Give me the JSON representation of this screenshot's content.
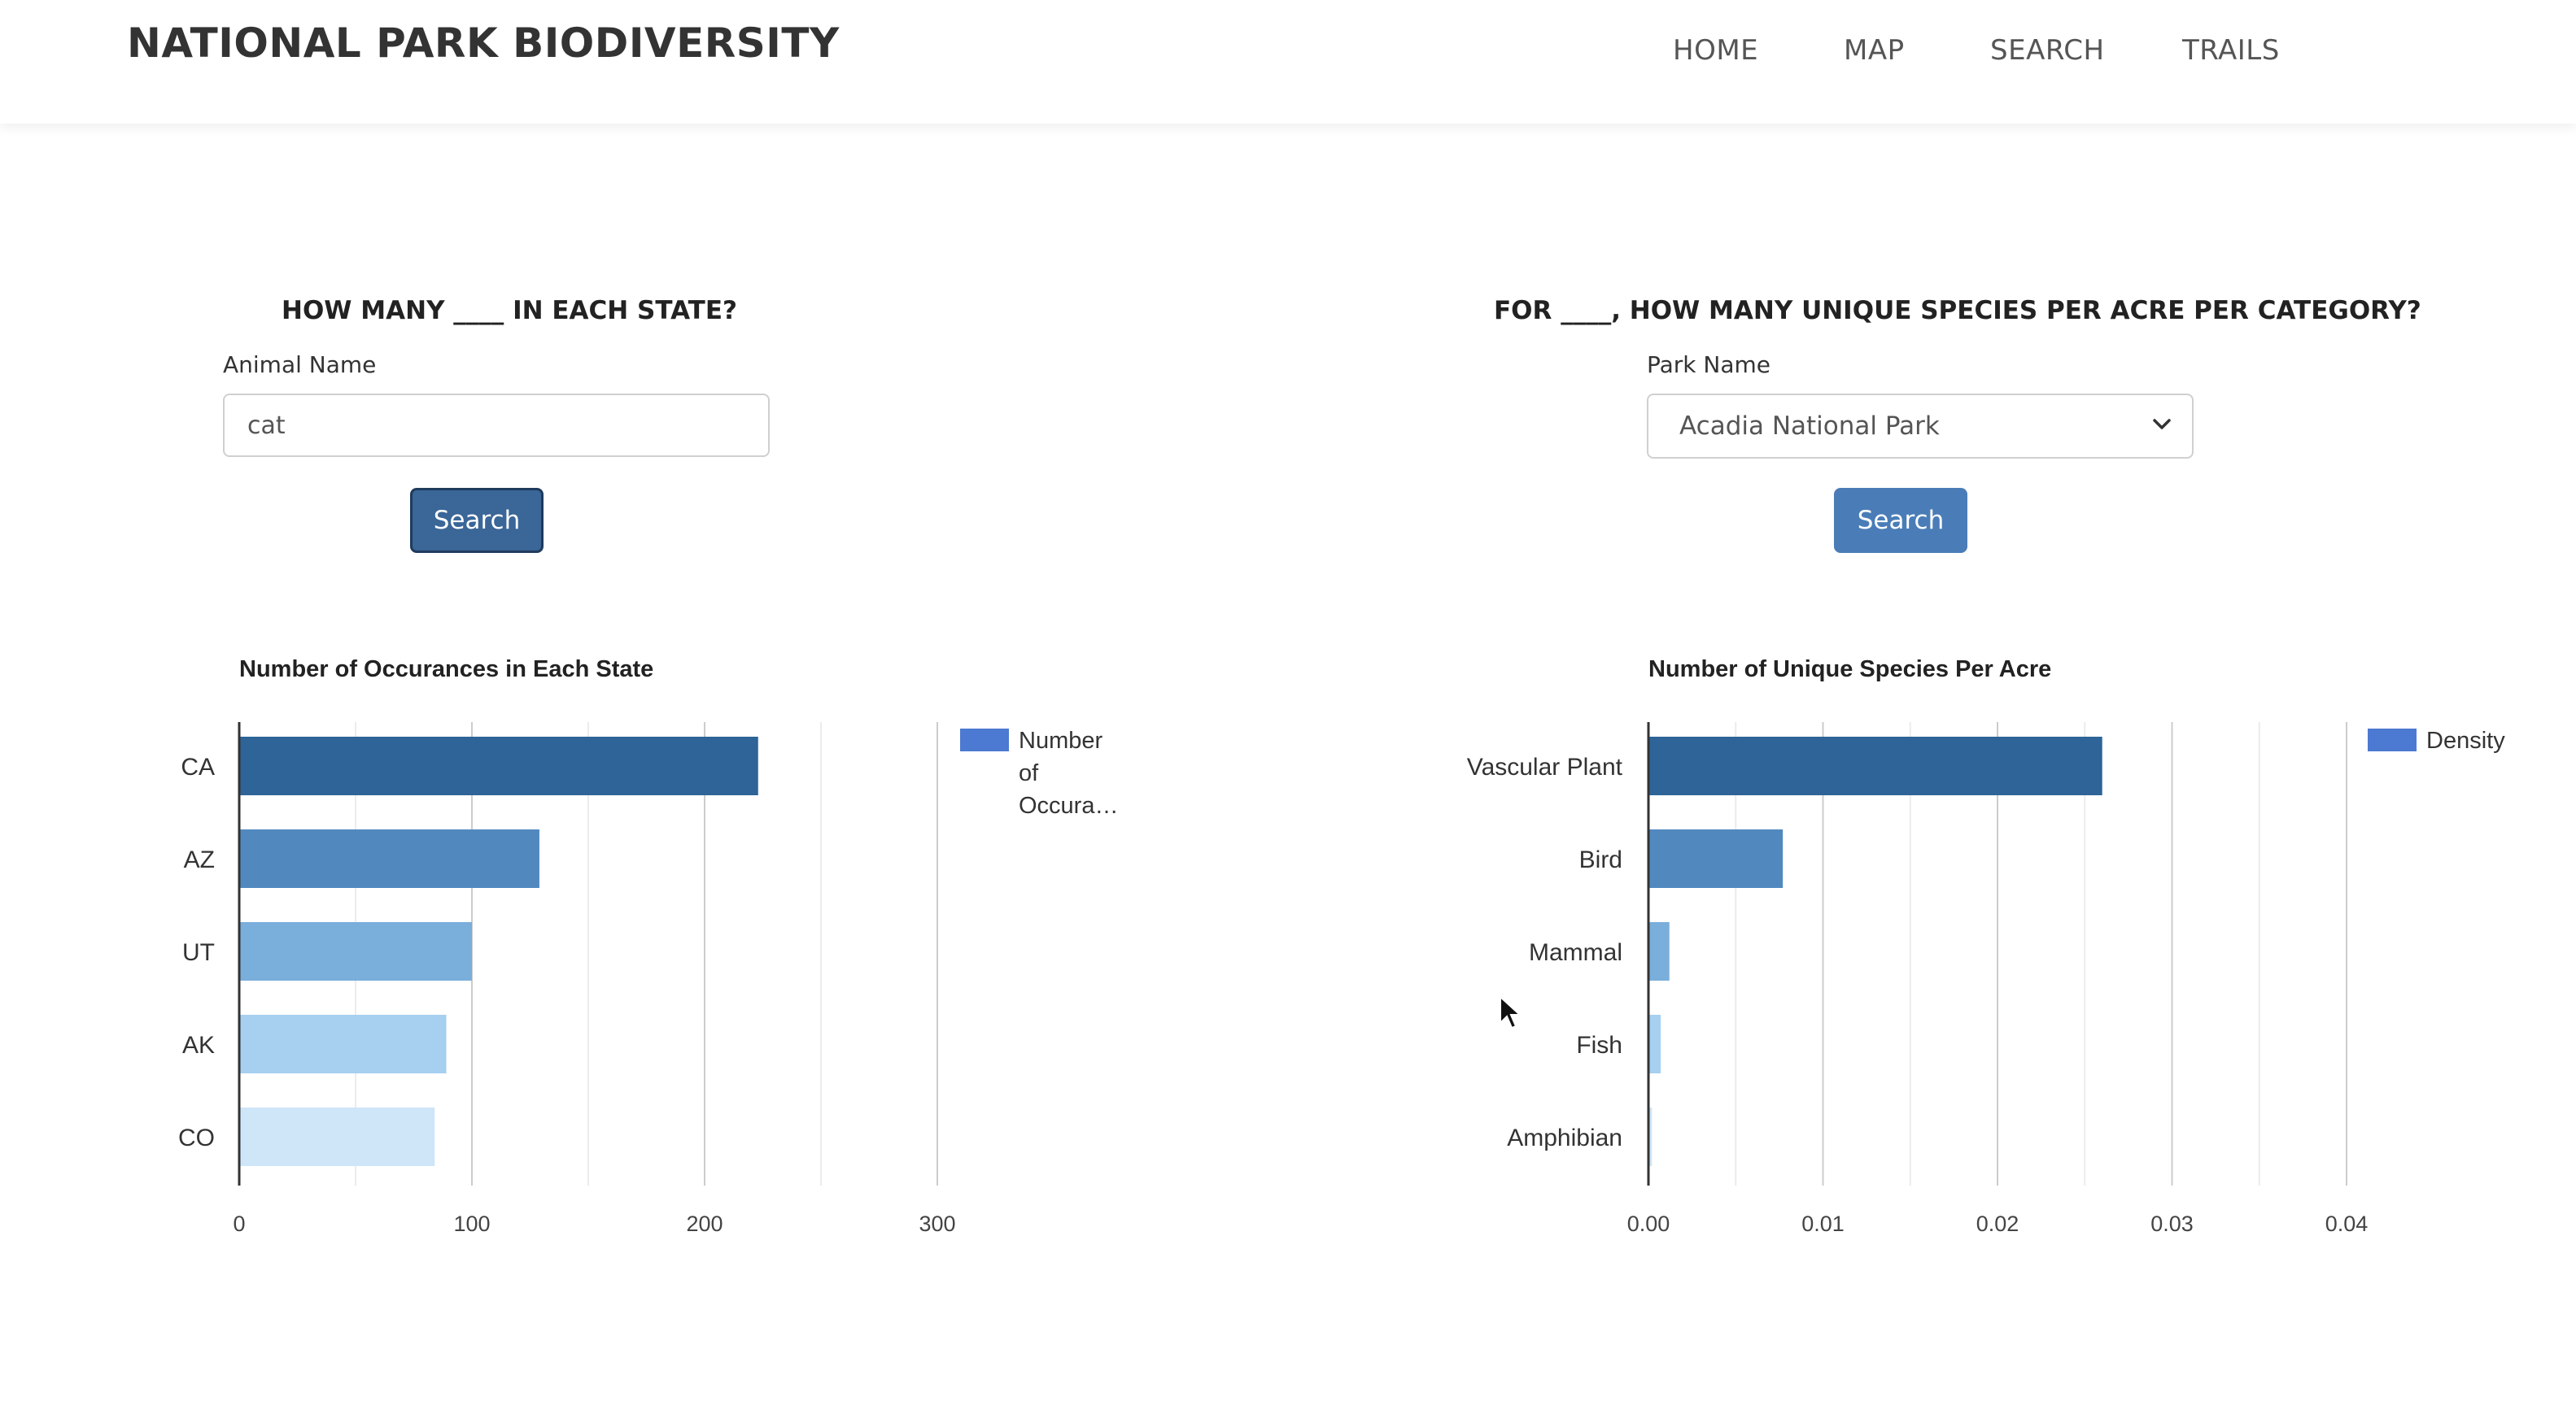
{
  "app": {
    "title": "NATIONAL PARK BIODIVERSITY"
  },
  "nav": {
    "items": [
      "HOME",
      "MAP",
      "SEARCH",
      "TRAILS"
    ]
  },
  "left_panel": {
    "title": "HOW MANY ____ IN EACH STATE?",
    "field_label": "Animal Name",
    "input_value": "cat",
    "button_label": "Search"
  },
  "right_panel": {
    "title": "FOR ____, HOW MANY UNIQUE SPECIES PER ACRE PER CATEGORY?",
    "field_label": "Park Name",
    "select_value": "Acadia National Park",
    "button_label": "Search"
  },
  "chart_data": [
    {
      "type": "bar",
      "orientation": "horizontal",
      "title": "Number of Occurances in Each State",
      "categories": [
        "CA",
        "AZ",
        "UT",
        "AK",
        "CO"
      ],
      "series": [
        {
          "name": "Number of Occura…",
          "values": [
            223,
            129,
            100,
            89,
            84
          ]
        }
      ],
      "bar_colors": [
        "#2e6497",
        "#5189bf",
        "#7aaedb",
        "#a6cff0",
        "#cfe5f8"
      ],
      "legend_color": "#4c79d1",
      "legend_lines": [
        "Number",
        "of",
        "Occura…"
      ],
      "xlim": [
        0,
        300
      ],
      "x_ticks": [
        0,
        100,
        200,
        300
      ],
      "x_tick_labels": [
        "0",
        "100",
        "200",
        "300"
      ],
      "grid": true,
      "legend_position": "right"
    },
    {
      "type": "bar",
      "orientation": "horizontal",
      "title": "Number of Unique Species Per Acre",
      "categories": [
        "Vascular Plant",
        "Bird",
        "Mammal",
        "Fish",
        "Amphibian"
      ],
      "series": [
        {
          "name": "Density",
          "values": [
            0.026,
            0.0077,
            0.0012,
            0.0007,
            0.0002
          ]
        }
      ],
      "bar_colors": [
        "#2e6497",
        "#5189bf",
        "#7aaedb",
        "#a6cff0",
        "#cfe5f8"
      ],
      "legend_color": "#4c79d1",
      "legend_lines": [
        "Density"
      ],
      "xlim": [
        0,
        0.04
      ],
      "x_ticks": [
        0,
        0.01,
        0.02,
        0.03,
        0.04
      ],
      "x_tick_labels": [
        "0.00",
        "0.01",
        "0.02",
        "0.03",
        "0.04"
      ],
      "grid": true,
      "legend_position": "right"
    }
  ]
}
